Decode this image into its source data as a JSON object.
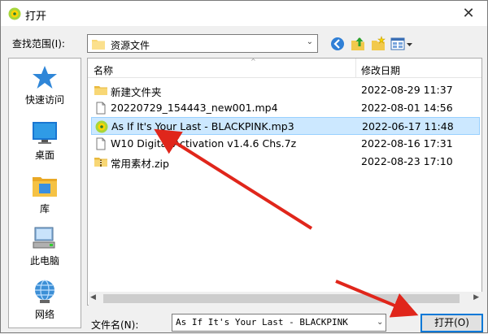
{
  "window": {
    "title": "打开",
    "close_glyph": "✕"
  },
  "lookin": {
    "label": "查找范围(I):",
    "value": "资源文件"
  },
  "places": [
    {
      "label": "快速访问",
      "icon": "star-icon"
    },
    {
      "label": "桌面",
      "icon": "desktop-icon"
    },
    {
      "label": "库",
      "icon": "library-icon"
    },
    {
      "label": "此电脑",
      "icon": "computer-icon"
    },
    {
      "label": "网络",
      "icon": "network-icon"
    }
  ],
  "columns": {
    "name": "名称",
    "date": "修改日期"
  },
  "files": [
    {
      "name": "新建文件夹",
      "date": "2022-08-29 11:37",
      "type": "folder"
    },
    {
      "name": "20220729_154443_new001.mp4",
      "date": "2022-08-01 14:56",
      "type": "file"
    },
    {
      "name": "As If It's Your Last - BLACKPINK.mp3",
      "date": "2022-06-17 11:48",
      "type": "audio",
      "selected": true
    },
    {
      "name": "W10 Digital Activation v1.4.6 Chs.7z",
      "date": "2022-08-16 17:31",
      "type": "file"
    },
    {
      "name": "常用素材.zip",
      "date": "2022-08-23 17:10",
      "type": "zip"
    }
  ],
  "filename": {
    "label": "文件名(N):",
    "value": "As If It's Your Last - BLACKPINK"
  },
  "open_button": "打开(O)",
  "colors": {
    "accent": "#0078d7",
    "selection": "#cce8ff",
    "arrow": "#e0261b"
  }
}
